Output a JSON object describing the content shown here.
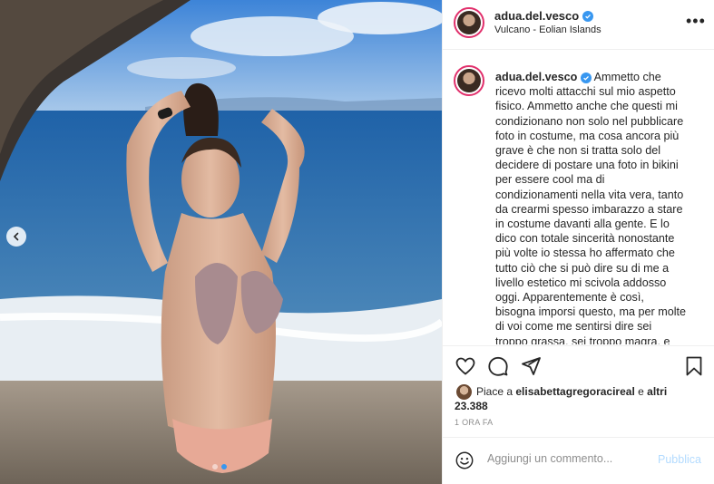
{
  "post": {
    "username": "adua.del.vesco",
    "location": "Vulcano - Eolian Islands",
    "caption": "Ammetto che ricevo molti attacchi sul mio aspetto fisico. Ammetto anche che questi mi condizionano non solo nel pubblicare foto in costume, ma cosa ancora più grave è che non si tratta solo del decidere di postare una foto in bikini per essere cool ma di condizionamenti nella vita vera, tanto da crearmi spesso imbarazzo a stare in costume davanti alla gente. E lo dico con totale sincerità nonostante più volte io stessa ho affermato che tutto ciò che si può dire su di me a livello estetico mi scivola addosso oggi. Apparentemente è così, bisogna imporsi questo, ma per molte di voi come me sentirsi dire sei troppo grassa, sei troppo magra, e poco alla",
    "more_icon": "more-options-icon",
    "verified_icon": "verified-badge-icon"
  },
  "likes": {
    "prefix": "Piace a",
    "liker": "elisabettagregoraci​real",
    "conjunction": "e",
    "others": "altri 23.388"
  },
  "timestamp": "1 ORA FA",
  "comment": {
    "placeholder": "Aggiungi un commento...",
    "publish_label": "Pubblica"
  },
  "carousel": {
    "count": 2,
    "active_index": 1
  },
  "colors": {
    "accent": "#3897f0",
    "publish_disabled": "#b3dbff",
    "muted_text": "#8e8e8e"
  }
}
